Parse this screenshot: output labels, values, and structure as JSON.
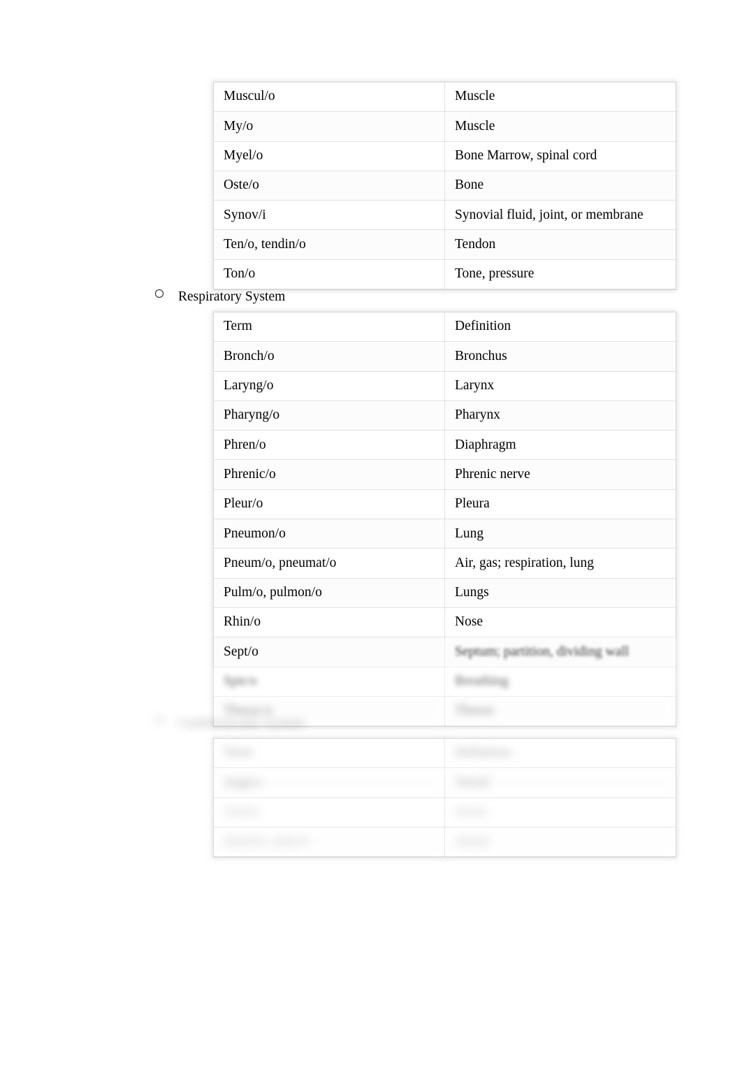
{
  "document": {
    "type": "medical-terminology-reference",
    "sections": [
      {
        "id": "musculoskeletal",
        "heading": "",
        "table": {
          "rows": [
            {
              "term": "Muscul/o",
              "definition": "Muscle"
            },
            {
              "term": "My/o",
              "definition": "Muscle"
            },
            {
              "term": "Myel/o",
              "definition": "Bone Marrow, spinal cord"
            },
            {
              "term": "Oste/o",
              "definition": "Bone"
            },
            {
              "term": "Synov/i",
              "definition": "Synovial fluid, joint, or membrane"
            },
            {
              "term": "Ten/o, tendin/o",
              "definition": "Tendon"
            },
            {
              "term": "Ton/o",
              "definition": "Tone, pressure"
            }
          ]
        }
      },
      {
        "id": "respiratory",
        "heading": "Respiratory System",
        "bullet": "hollow-circle",
        "table": {
          "rows": [
            {
              "term": "Term",
              "definition": "Definition"
            },
            {
              "term": "Bronch/o",
              "definition": "Bronchus"
            },
            {
              "term": "Laryng/o",
              "definition": "Larynx"
            },
            {
              "term": "Pharyng/o",
              "definition": "Pharynx"
            },
            {
              "term": "Phren/o",
              "definition": "Diaphragm"
            },
            {
              "term": "Phrenic/o",
              "definition": "Phrenic nerve"
            },
            {
              "term": "Pleur/o",
              "definition": "Pleura"
            },
            {
              "term": "Pneumon/o",
              "definition": "Lung"
            },
            {
              "term": "Pneum/o, pneumat/o",
              "definition": "Air, gas; respiration, lung"
            },
            {
              "term": "Pulm/o, pulmon/o",
              "definition": "Lungs"
            },
            {
              "term": "Rhin/o",
              "definition": "Nose"
            },
            {
              "term": "Sept/o",
              "definition": "Septum; partition, dividing wall"
            },
            {
              "term": "Spir/o",
              "definition": "Breathing"
            },
            {
              "term": "Thorac/o",
              "definition": "Thorax"
            }
          ]
        }
      },
      {
        "id": "cardiovascular",
        "heading": "Cardiovascular System",
        "bullet": "hollow-circle",
        "table": {
          "rows": [
            {
              "term": "Term",
              "definition": "Definition"
            },
            {
              "term": "Angi/o",
              "definition": "Vessel"
            },
            {
              "term": "Aort/o",
              "definition": "Aorta"
            },
            {
              "term": "Arteri/o, arter/o",
              "definition": "Artery"
            }
          ]
        }
      }
    ]
  }
}
